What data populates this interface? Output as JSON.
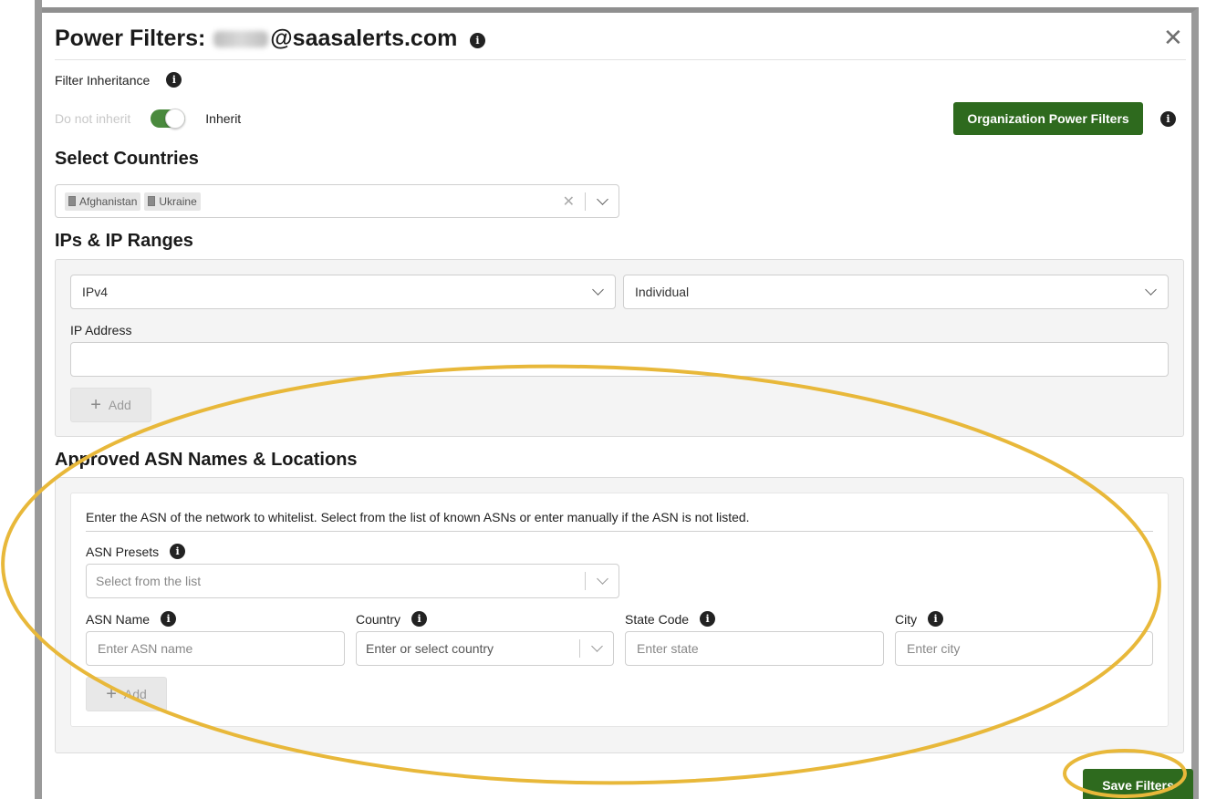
{
  "modal": {
    "title_prefix": "Power Filters:",
    "title_suffix": "@saasalerts.com",
    "close_glyph": "✕"
  },
  "inheritance": {
    "label": "Filter Inheritance",
    "off_label": "Do not inherit",
    "on_label": "Inherit",
    "state": "inherit",
    "org_button": "Organization Power Filters"
  },
  "countries": {
    "heading": "Select Countries",
    "selected": [
      "Afghanistan",
      "Ukraine"
    ]
  },
  "ip_ranges": {
    "heading": "IPs & IP Ranges",
    "version_value": "IPv4",
    "type_value": "Individual",
    "address_label": "IP Address",
    "address_value": "",
    "add_label": "Add"
  },
  "asn": {
    "heading": "Approved ASN Names & Locations",
    "description": "Enter the ASN of the network to whitelist. Select from the list of known ASNs or enter manually if the ASN is not listed.",
    "presets_label": "ASN Presets",
    "presets_placeholder": "Select from the list",
    "name_label": "ASN Name",
    "name_placeholder": "Enter ASN name",
    "country_label": "Country",
    "country_placeholder": "Enter or select country",
    "state_label": "State Code",
    "state_placeholder": "Enter state",
    "city_label": "City",
    "city_placeholder": "Enter city",
    "add_label": "Add"
  },
  "footer": {
    "save_label": "Save Filters"
  },
  "colors": {
    "primary_green": "#2e6a1e",
    "toggle_green": "#4a8a3e",
    "highlight_gold": "#e8b83a"
  }
}
